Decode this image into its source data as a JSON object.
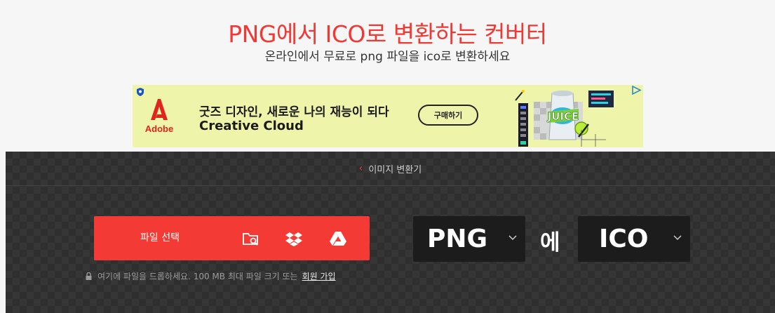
{
  "page": {
    "title": "PNG에서 ICO로 변환하는 컨버터",
    "subtitle": "온라인에서 무료로 png 파일을 ico로 변환하세요"
  },
  "ad": {
    "brand": "Adobe",
    "headline": "굿즈 디자인, 새로운 나의 재능이 되다",
    "product": "Creative Cloud",
    "cta": "구매하기",
    "art_label": "JUICE",
    "colors": {
      "background": "#eef5aa",
      "brand_red": "#e1251b"
    }
  },
  "converter": {
    "breadcrumb": "이미지 변환기",
    "upload": {
      "label": "파일 선택",
      "icons": [
        "folder-search-icon",
        "dropbox-icon",
        "google-drive-icon"
      ]
    },
    "note_text": "여기에 파일을 드롭하세요. 100 MB 최대 파일 크기 또는",
    "signup_link": "회원 가입",
    "from_format": "PNG",
    "connector": "에",
    "to_format": "ICO",
    "colors": {
      "accent": "#f33a35",
      "panel": "#2f2f2f",
      "select_bg": "#1c1c1c"
    }
  }
}
